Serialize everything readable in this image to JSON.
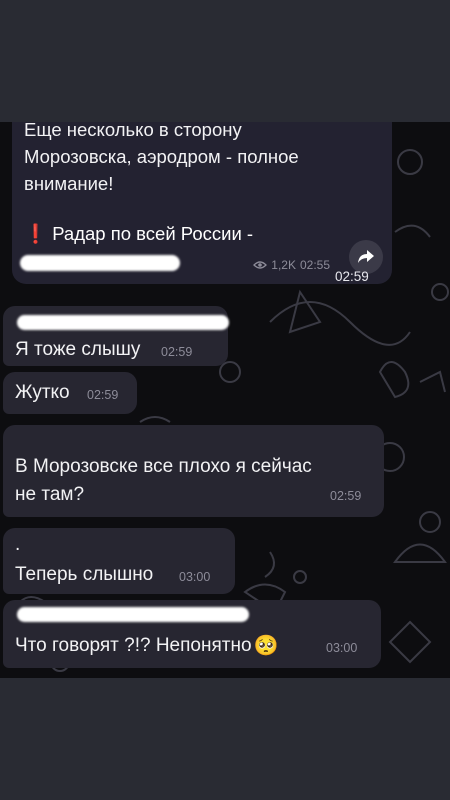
{
  "forwarded": {
    "text_lines": [
      "Еще несколько в сторону",
      "Морозовска, аэродром - полное",
      "внимание!"
    ],
    "radar_icon": "❗",
    "radar_text": "Радар по всей России -",
    "views": "1,2K",
    "post_time": "02:55",
    "share_icon": "share-arrow-icon",
    "time": "02:59"
  },
  "messages": [
    {
      "text": "Я тоже слышу",
      "time": "02:59"
    },
    {
      "text": "Жутко",
      "time": "02:59"
    },
    {
      "text_lines": [
        "В Морозовске все плохо я сейчас",
        "не там?"
      ],
      "time": "02:59"
    },
    {
      "dot": ".",
      "text": "Теперь слышно",
      "time": "03:00"
    },
    {
      "text": "Что говорят ?!? Непонятно",
      "emoji": "🥺",
      "time": "03:00"
    }
  ],
  "colors": {
    "bubble": "#272631",
    "chat_bg": "#0d0d10",
    "page_bg": "#292b33",
    "time": "#8d8c99"
  }
}
